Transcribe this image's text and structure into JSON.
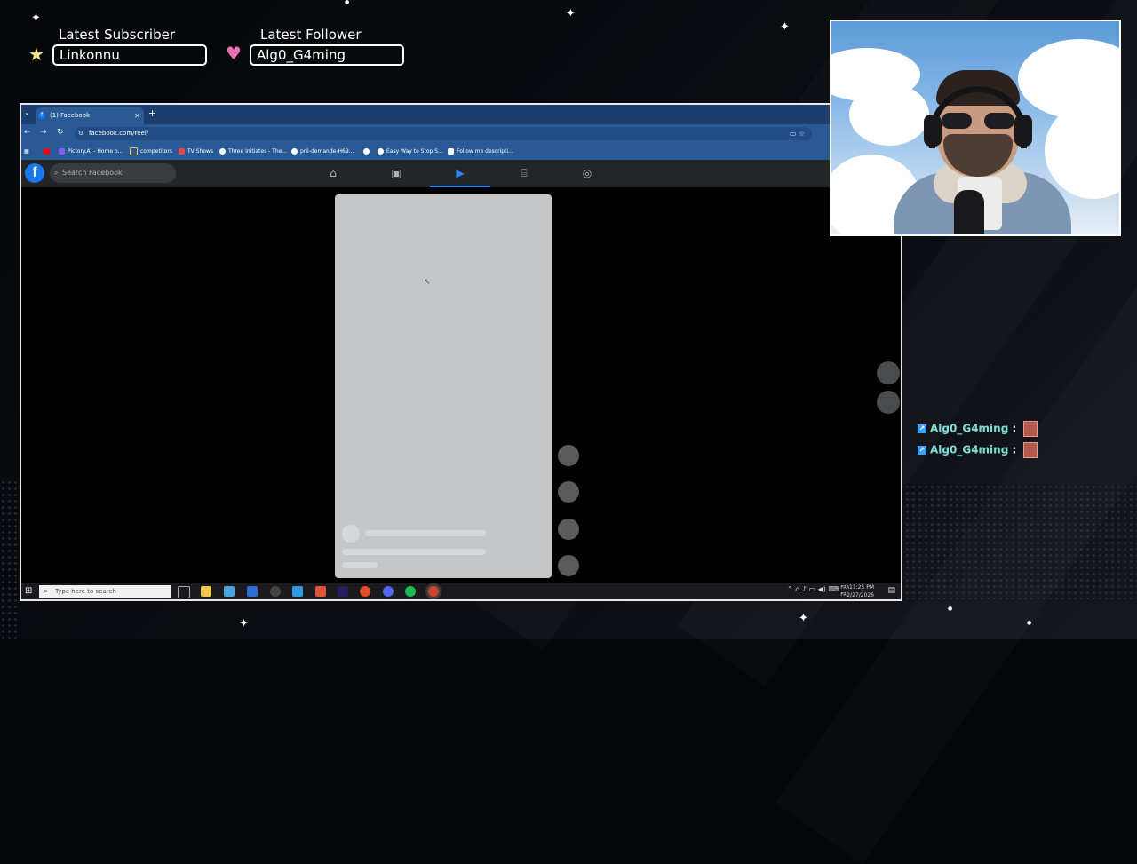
{
  "overlay": {
    "subscriber_title": "Latest Subscriber",
    "subscriber_name": "Linkonnu",
    "follower_title": "Latest Follower",
    "follower_name": "Alg0_G4ming"
  },
  "browser": {
    "tab_title": "(1) Facebook",
    "url": "facebook.com/reel/",
    "bookmarks": [
      {
        "label": "Pictory.AI - Home o...",
        "color": "#8a5cf6"
      },
      {
        "label": "competitors",
        "color": "#f2c94c"
      },
      {
        "label": "TV Shows",
        "color": "#e5484d"
      },
      {
        "label": "Three Initiates - The...",
        "color": "#ffffff"
      },
      {
        "label": "pré-demande-H69...",
        "color": "#ffffff"
      },
      {
        "label": "Easy Way to Stop S...",
        "color": "#ffffff"
      },
      {
        "label": "Follow me descripti...",
        "color": "#ffffff"
      }
    ]
  },
  "facebook": {
    "logo": "f",
    "search_placeholder": "Search Facebook",
    "nav_icons": [
      "home-icon",
      "watch-icon",
      "reels-icon",
      "marketplace-icon",
      "gaming-icon"
    ],
    "active_nav": "reels-icon"
  },
  "taskbar": {
    "search_placeholder": "Type here to search",
    "lang": "FRA",
    "lang_sub": "FR",
    "time": "11:25 PM",
    "date": "2/27/2026"
  },
  "chat": [
    {
      "user": "Alg0_G4ming",
      "sep": ":"
    },
    {
      "user": "Alg0_G4ming",
      "sep": ":"
    }
  ],
  "colors": {
    "facebook_blue": "#1877f2",
    "browser_chrome": "#2a5a96",
    "chat_name": "#7ee0d5"
  }
}
